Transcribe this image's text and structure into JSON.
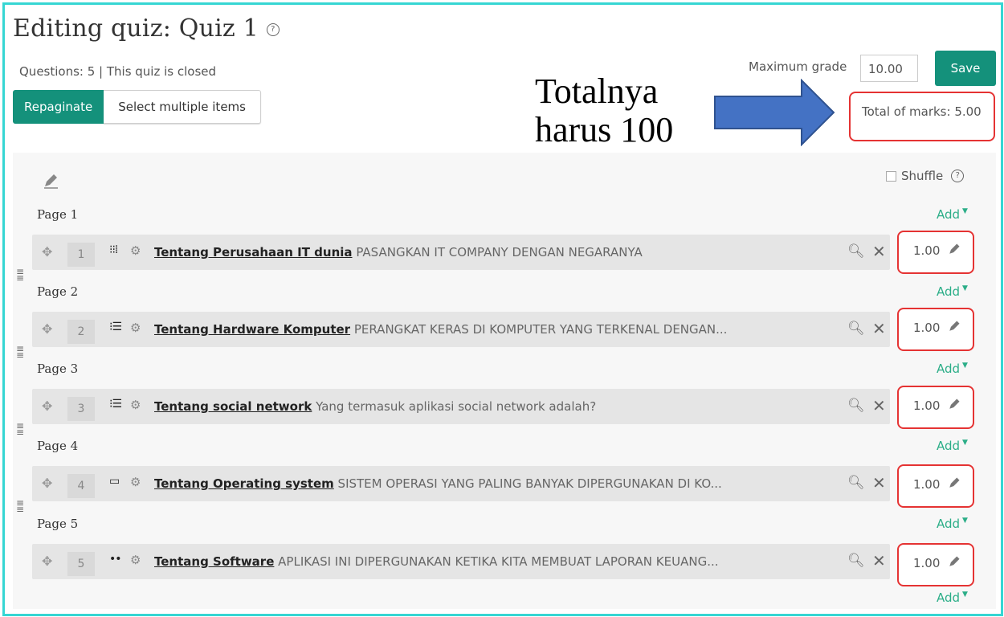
{
  "title": "Editing quiz: Quiz 1",
  "help_icon": "?",
  "status": "Questions: 5 | This quiz is closed",
  "buttons": {
    "repaginate": "Repaginate",
    "select_multiple": "Select multiple items",
    "save": "Save"
  },
  "max_grade": {
    "label": "Maximum grade",
    "value": "10.00"
  },
  "total_marks": "Total of marks: 5.00",
  "annotation": {
    "line1": "Totalnya",
    "line2": "harus 100"
  },
  "shuffle": {
    "label": "Shuffle",
    "help": "?"
  },
  "add_label": "Add",
  "pages": [
    {
      "page": "Page 1",
      "num": "1",
      "icon": "⁝⁝⁞",
      "name": "Tentang Perusahaan IT dunia",
      "text": "PASANGKAN IT COMPANY DENGAN NEGARANYA",
      "mark": "1.00"
    },
    {
      "page": "Page 2",
      "num": "2",
      "icon": "⁝☰",
      "name": "Tentang Hardware Komputer",
      "text": "PERANGKAT KERAS DI KOMPUTER YANG TERKENAL DENGAN...",
      "mark": "1.00"
    },
    {
      "page": "Page 3",
      "num": "3",
      "icon": "⁝☰",
      "name": "Tentang social network",
      "text": "Yang termasuk aplikasi social network adalah?",
      "mark": "1.00"
    },
    {
      "page": "Page 4",
      "num": "4",
      "icon": "▭",
      "name": "Tentang Operating system",
      "text": "SISTEM OPERASI YANG PALING BANYAK DIPERGUNAKAN DI KO...",
      "mark": "1.00"
    },
    {
      "page": "Page 5",
      "num": "5",
      "icon": "••",
      "name": "Tentang Software",
      "text": "APLIKASI INI DIPERGUNAKAN KETIKA KITA MEMBUAT LAPORAN KEUANG...",
      "mark": "1.00"
    }
  ],
  "colors": {
    "accent": "#14917b",
    "highlight": "#e53333",
    "frame": "#36d6d3",
    "arrow": "#4472c4"
  }
}
